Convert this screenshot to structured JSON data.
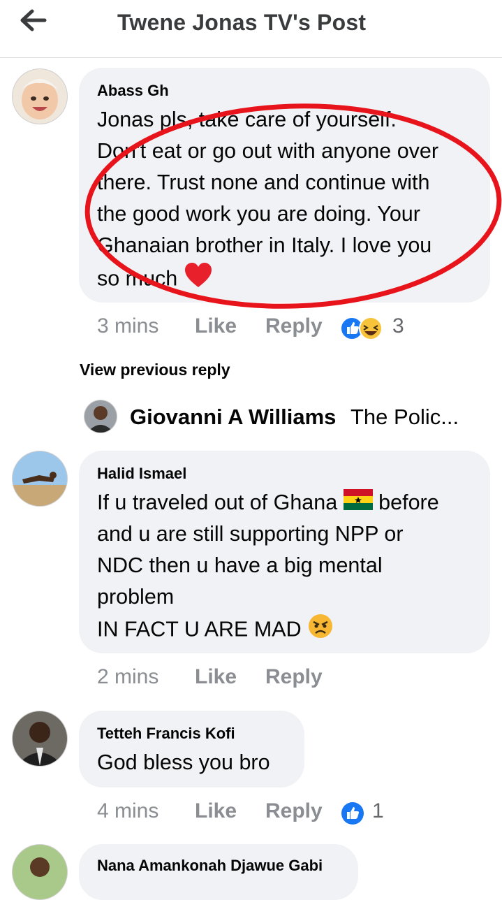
{
  "header": {
    "title": "Twene Jonas TV's Post",
    "back_icon": "arrow-left-icon"
  },
  "comments": [
    {
      "author": "Abass Gh",
      "lines": [
        "Jonas pls, take care of yourself.",
        "Don't eat or go out with anyone over",
        "there. Trust none and continue with",
        "the good work you are doing. Your",
        "Ghanaian brother in Italy. I love  you",
        "so much"
      ],
      "emoji": "heart-emoji",
      "time": "3 mins",
      "like": "Like",
      "reply": "Reply",
      "reactions": [
        "like-reaction-icon",
        "laugh-reaction-icon"
      ],
      "reaction_count": "3"
    },
    {
      "author": "Halid Ismael",
      "lines": [
        "If u traveled out of Ghana",
        "and u are still supporting NPP or",
        "NDC then u have a big mental",
        "problem",
        "IN FACT U ARE MAD"
      ],
      "line1_suffix": "before",
      "emoji": "angry-emoji",
      "flag": "ghana-flag-emoji",
      "time": "2 mins",
      "like": "Like",
      "reply": "Reply"
    },
    {
      "author": "Tetteh Francis Kofi",
      "lines": [
        "God bless you bro"
      ],
      "time": "4 mins",
      "like": "Like",
      "reply": "Reply",
      "reactions": [
        "like-reaction-icon"
      ],
      "reaction_count": "1"
    },
    {
      "author": "Nana Amankonah Djawue Gabi"
    }
  ],
  "view_previous": "View previous reply",
  "reply_preview": {
    "author": "Giovanni A Williams",
    "text": "The Polic..."
  },
  "annotation_color": "#e8141b"
}
